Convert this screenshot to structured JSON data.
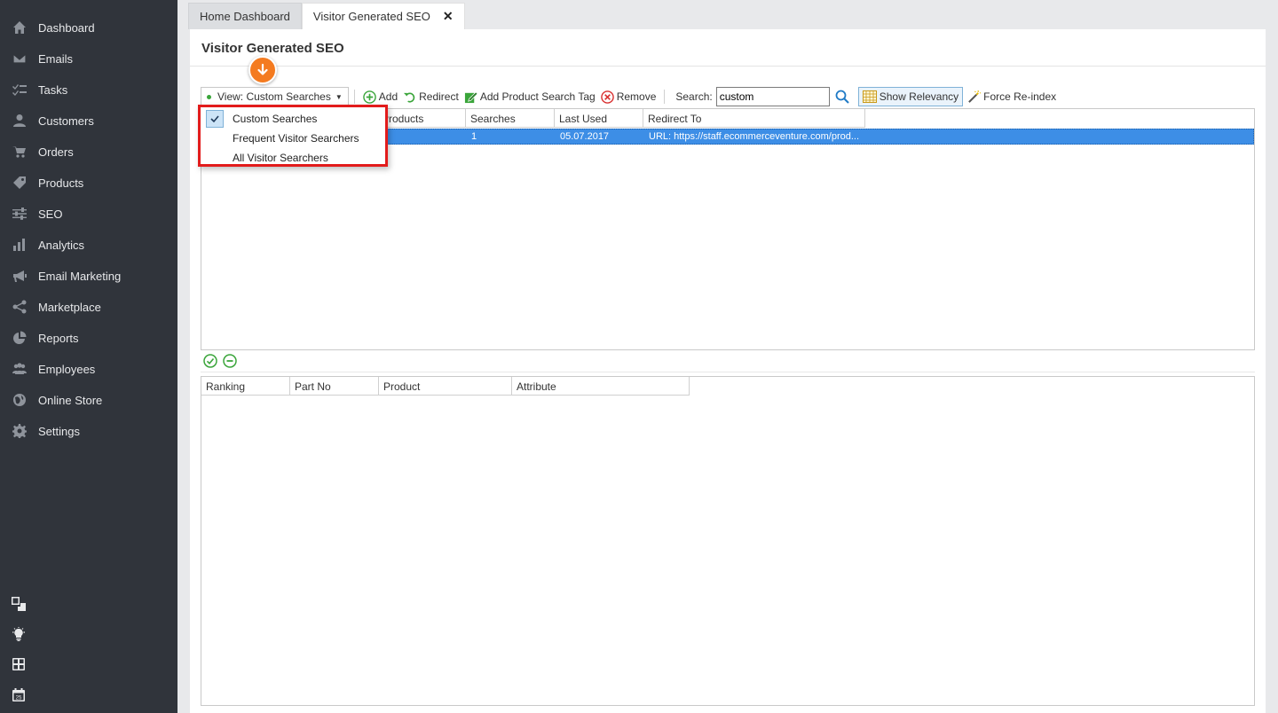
{
  "sidebar": {
    "items": [
      {
        "label": "Dashboard",
        "icon": "home-icon"
      },
      {
        "label": "Emails",
        "icon": "mail-icon"
      },
      {
        "label": "Tasks",
        "icon": "tasks-icon"
      },
      {
        "label": "Customers",
        "icon": "person-icon"
      },
      {
        "label": "Orders",
        "icon": "cart-icon"
      },
      {
        "label": "Products",
        "icon": "tag-icon"
      },
      {
        "label": "SEO",
        "icon": "sliders-icon"
      },
      {
        "label": "Analytics",
        "icon": "bar-chart-icon"
      },
      {
        "label": "Email Marketing",
        "icon": "megaphone-icon"
      },
      {
        "label": "Marketplace",
        "icon": "share-icon"
      },
      {
        "label": "Reports",
        "icon": "pie-chart-icon"
      },
      {
        "label": "Employees",
        "icon": "group-icon"
      },
      {
        "label": "Online Store",
        "icon": "globe-icon"
      },
      {
        "label": "Settings",
        "icon": "gear-icon"
      }
    ],
    "utility_icons": [
      "windows-icon",
      "lightbulb-icon",
      "calculator-icon",
      "calendar-icon"
    ],
    "calendar_day": "25"
  },
  "tabs": [
    {
      "label": "Home Dashboard"
    },
    {
      "label": "Visitor Generated SEO",
      "close": "✕"
    }
  ],
  "page": {
    "title": "Visitor Generated SEO"
  },
  "toolbar": {
    "view_label": "View: Custom Searches",
    "add_label": "Add",
    "redirect_label": "Redirect",
    "add_tag_label": "Add Product Search Tag",
    "remove_label": "Remove",
    "search_label": "Search:",
    "search_value": "custom",
    "show_relevancy_label": "Show Relevancy",
    "force_reindex_label": "Force Re-index"
  },
  "view_menu": {
    "items": [
      {
        "label": "Custom Searches",
        "checked": true
      },
      {
        "label": "Frequent Visitor Searchers",
        "checked": false
      },
      {
        "label": "All Visitor Searchers",
        "checked": false
      }
    ]
  },
  "grid1": {
    "columns": [
      "",
      "Products",
      "Searches",
      "Last Used",
      "Redirect To"
    ],
    "rows": [
      {
        "products": "",
        "searches": "1",
        "last_used": "05.07.2017",
        "redirect_to": "URL: https://staff.ecommerceventure.com/prod..."
      }
    ]
  },
  "grid2": {
    "columns": [
      "Ranking",
      "Part No",
      "Product",
      "Attribute"
    ]
  },
  "colors": {
    "sidebar_bg": "#30343b",
    "accent_orange": "#f47b20",
    "highlight_red": "#e21b1b",
    "row_selected": "#3d8ee6"
  }
}
